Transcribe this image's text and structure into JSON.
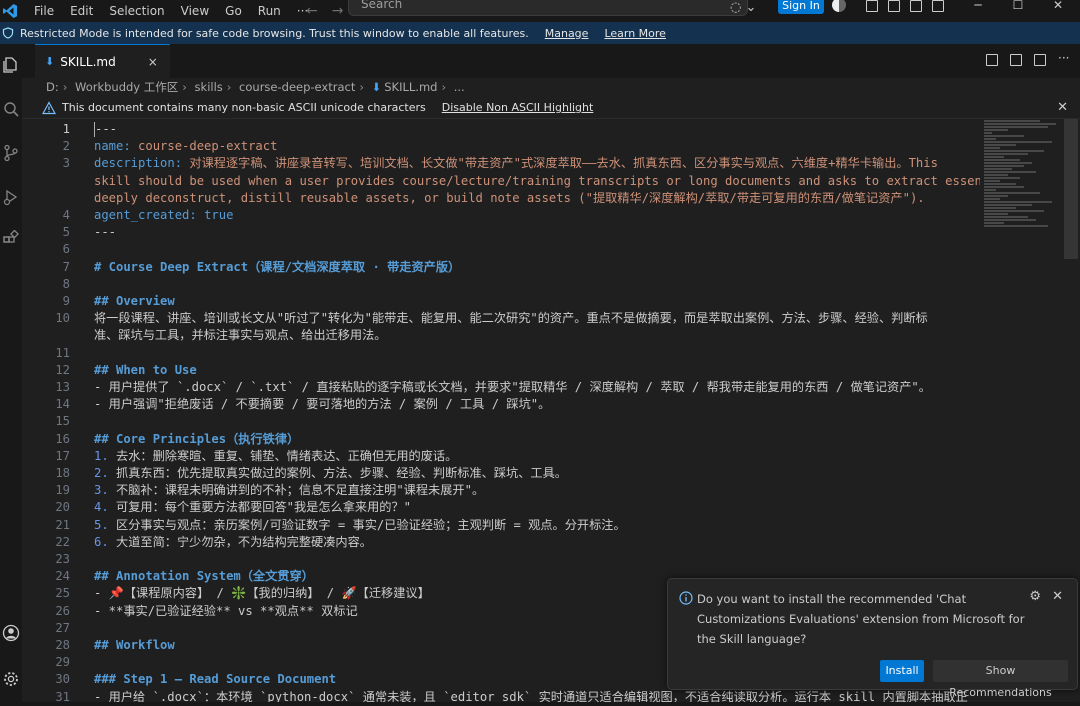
{
  "menu": [
    "File",
    "Edit",
    "Selection",
    "View",
    "Go",
    "Run",
    "···"
  ],
  "command_center": {
    "placeholder": "Search"
  },
  "titlebar": {
    "sign_in": "Sign In"
  },
  "restricted_banner": {
    "message": "Restricted Mode is intended for safe code browsing. Trust this window to enable all features.",
    "manage": "Manage",
    "learn_more": "Learn More"
  },
  "tab": {
    "label": "SKILL.md",
    "close": "×"
  },
  "breadcrumb": [
    "D:",
    "Workbuddy 工作区",
    "skills",
    "course-deep-extract",
    "SKILL.md",
    "..."
  ],
  "ascii_bar": {
    "message": "This document contains many non-basic ASCII unicode characters",
    "action": "Disable Non ASCII Highlight"
  },
  "editor": {
    "lines": [
      {
        "n": "1",
        "text": "---"
      },
      {
        "n": "2",
        "key": "name:",
        "val": " course-deep-extract"
      },
      {
        "n": "3",
        "key": "description:",
        "val": " 对课程逐字稿、讲座录音转写、培训文档、长文做\"带走资产\"式深度萃取——去水、抓真东西、区分事实与观点、六维度+精华卡输出。This"
      },
      {
        "n": "",
        "val": "skill should be used when a user provides course/lecture/training transcripts or long documents and asks to extract essence,"
      },
      {
        "n": "",
        "val": "deeply deconstruct, distill reusable assets, or build note assets (\"提取精华/深度解构/萃取/带走可复用的东西/做笔记资产\")."
      },
      {
        "n": "4",
        "key": "agent_created:",
        "bool": " true"
      },
      {
        "n": "5",
        "text": "---"
      },
      {
        "n": "6",
        "text": ""
      },
      {
        "n": "7",
        "head": "# Course Deep Extract（课程/文档深度萃取 · 带走资产版）"
      },
      {
        "n": "8",
        "text": ""
      },
      {
        "n": "9",
        "head": "## Overview"
      },
      {
        "n": "10",
        "text": "将一段课程、讲座、培训或长文从\"听过了\"转化为\"能带走、能复用、能二次研究\"的资产。重点不是做摘要，而是萃取出案例、方法、步骤、经验、判断标"
      },
      {
        "n": "",
        "text": "准、踩坑与工具，并标注事实与观点、给出迁移用法。"
      },
      {
        "n": "11",
        "text": ""
      },
      {
        "n": "12",
        "head": "## When to Use"
      },
      {
        "n": "13",
        "text": "- 用户提供了 `.docx` / `.txt` / 直接粘贴的逐字稿或长文档，并要求\"提取精华 / 深度解构 / 萃取 / 帮我带走能复用的东西 / 做笔记资产\"。"
      },
      {
        "n": "14",
        "text": "- 用户强调\"拒绝废话 / 不要摘要 / 要可落地的方法 / 案例 / 工具 / 踩坑\"。"
      },
      {
        "n": "15",
        "text": ""
      },
      {
        "n": "16",
        "head": "## Core Principles（执行铁律）"
      },
      {
        "n": "17",
        "num": "1.",
        "text": " 去水：删除寒暄、重复、铺垫、情绪表达、正确但无用的废话。"
      },
      {
        "n": "18",
        "num": "2.",
        "text": " 抓真东西：优先提取真实做过的案例、方法、步骤、经验、判断标准、踩坑、工具。"
      },
      {
        "n": "19",
        "num": "3.",
        "text": " 不脑补：课程未明确讲到的不补；信息不足直接注明\"课程未展开\"。"
      },
      {
        "n": "20",
        "num": "4.",
        "text": " 可复用：每个重要方法都要回答\"我是怎么拿来用的？\""
      },
      {
        "n": "21",
        "num": "5.",
        "text": " 区分事实与观点：亲历案例/可验证数字 = 事实/已验证经验；主观判断 = 观点。分开标注。"
      },
      {
        "n": "22",
        "num": "6.",
        "text": " 大道至简：宁少勿杂，不为结构完整硬凑内容。"
      },
      {
        "n": "23",
        "text": ""
      },
      {
        "n": "24",
        "head": "## Annotation System（全文贯穿）"
      },
      {
        "n": "25",
        "text": "- 📌【课程原内容】 / ❇️【我的归纳】 / 🚀【迁移建议】"
      },
      {
        "n": "26",
        "text": "- **事实/已验证经验** vs **观点** 双标记"
      },
      {
        "n": "27",
        "text": ""
      },
      {
        "n": "28",
        "head": "## Workflow"
      },
      {
        "n": "29",
        "text": ""
      },
      {
        "n": "30",
        "head": "### Step 1 — Read Source Document"
      },
      {
        "n": "31",
        "text": "- 用户给 `.docx`：本环境 `python-docx` 通常未装，且 `editor_sdk` 实时通道只适合编辑视图，不适合纯读取分析。运行本 skill 内置脚本抽取正"
      }
    ]
  },
  "notification": {
    "message": "Do you want to install the recommended 'Chat Customizations Evaluations' extension from Microsoft for the Skill language?",
    "install": "Install",
    "show_recommendations": "Show Recommendations"
  },
  "colors": {
    "accent": "#0078d4",
    "banner": "#14324f",
    "keyword": "#569cd6",
    "string": "#ce9178"
  }
}
